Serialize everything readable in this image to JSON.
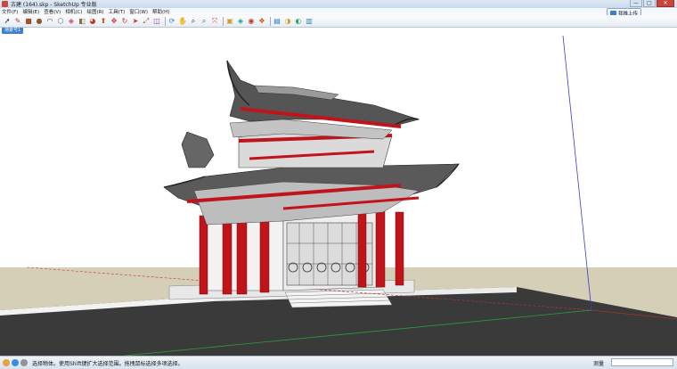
{
  "window": {
    "title": "古建 (164).skp - SketchUp 专业版",
    "controls": {
      "minimize": "—",
      "maximize": "□",
      "close": "✕"
    }
  },
  "menubar": {
    "items": [
      {
        "label": "文件(F)"
      },
      {
        "label": "编辑(E)"
      },
      {
        "label": "查看(V)"
      },
      {
        "label": "相机(C)"
      },
      {
        "label": "绘图(R)"
      },
      {
        "label": "工具(T)"
      },
      {
        "label": "窗口(W)"
      },
      {
        "label": "帮助(H)"
      }
    ],
    "share_button": {
      "label": "我推上传",
      "icon": "cloud-share-icon"
    }
  },
  "toolbar": {
    "tools": [
      {
        "name": "select-tool-icon",
        "glyph": "➚",
        "color": "#222222"
      },
      {
        "name": "pencil-tool-icon",
        "glyph": "✎",
        "color": "#c0392b"
      },
      {
        "name": "rectangle-tool-icon",
        "glyph": "■",
        "color": "#a0522d"
      },
      {
        "name": "circle-tool-icon",
        "glyph": "●",
        "color": "#8b5a2b"
      },
      {
        "name": "arc-tool-icon",
        "glyph": "◠",
        "color": "#444444"
      },
      {
        "name": "polygon-tool-icon",
        "glyph": "⬡",
        "color": "#666666"
      },
      {
        "name": "eraser-tool-icon",
        "glyph": "◆",
        "color": "#d4708a"
      },
      {
        "name": "tape-measure-tool-icon",
        "glyph": "◧",
        "color": "#8a6d3b"
      },
      {
        "name": "paint-bucket-tool-icon",
        "glyph": "◕",
        "color": "#c0392b"
      },
      {
        "name": "push-pull-tool-icon",
        "glyph": "⬆",
        "color": "#d35400"
      },
      {
        "name": "move-tool-icon",
        "glyph": "✥",
        "color": "#c0392b"
      },
      {
        "name": "rotate-tool-icon",
        "glyph": "↻",
        "color": "#c0392b"
      },
      {
        "name": "follow-me-tool-icon",
        "glyph": "➤",
        "color": "#c0392b"
      },
      {
        "name": "scale-tool-icon",
        "glyph": "⤢",
        "color": "#c0392b"
      },
      {
        "name": "offset-tool-icon",
        "glyph": "◫",
        "color": "#8e44ad"
      },
      {
        "name": "orbit-tool-icon",
        "glyph": "⟳",
        "color": "#2e86c1"
      },
      {
        "name": "pan-tool-icon",
        "glyph": "✋",
        "color": "#5d6d7e"
      },
      {
        "name": "zoom-tool-icon",
        "glyph": "⌕",
        "color": "#333333"
      },
      {
        "name": "zoom-window-tool-icon",
        "glyph": "⌕",
        "color": "#555555"
      },
      {
        "name": "zoom-extents-tool-icon",
        "glyph": "⤧",
        "color": "#c0392b"
      },
      {
        "name": "warehouse-icon",
        "glyph": "▣",
        "color": "#c9a227"
      },
      {
        "name": "get-models-icon",
        "glyph": "◈",
        "color": "#16a085"
      },
      {
        "name": "share-model-icon",
        "glyph": "◉",
        "color": "#c0392b"
      },
      {
        "name": "components-icon",
        "glyph": "❖",
        "color": "#d35400"
      },
      {
        "name": "extension-warehouse-icon",
        "glyph": "▤",
        "color": "#2980b9"
      },
      {
        "name": "layout-send-icon",
        "glyph": "◑",
        "color": "#c9a227"
      },
      {
        "name": "styles-icon",
        "glyph": "◐",
        "color": "#27ae60"
      },
      {
        "name": "scenes-icon",
        "glyph": "▥",
        "color": "#2e86c1"
      }
    ]
  },
  "scene_tab": {
    "label": "场景号1"
  },
  "viewport": {
    "colors": {
      "sky": "#ffffff",
      "ground": "#d6cfb7",
      "floor": "#3b3b3b",
      "red": "#c0141a",
      "roof": "#4a4a4a"
    }
  },
  "statusbar": {
    "icons": [
      "info-icon",
      "geo-location-icon",
      "credits-icon"
    ],
    "hint": "选择物体。使用Shift键扩大选择范围。拖拽鼠标选择多项选择。",
    "measure_label": "测量",
    "measure_value": ""
  }
}
